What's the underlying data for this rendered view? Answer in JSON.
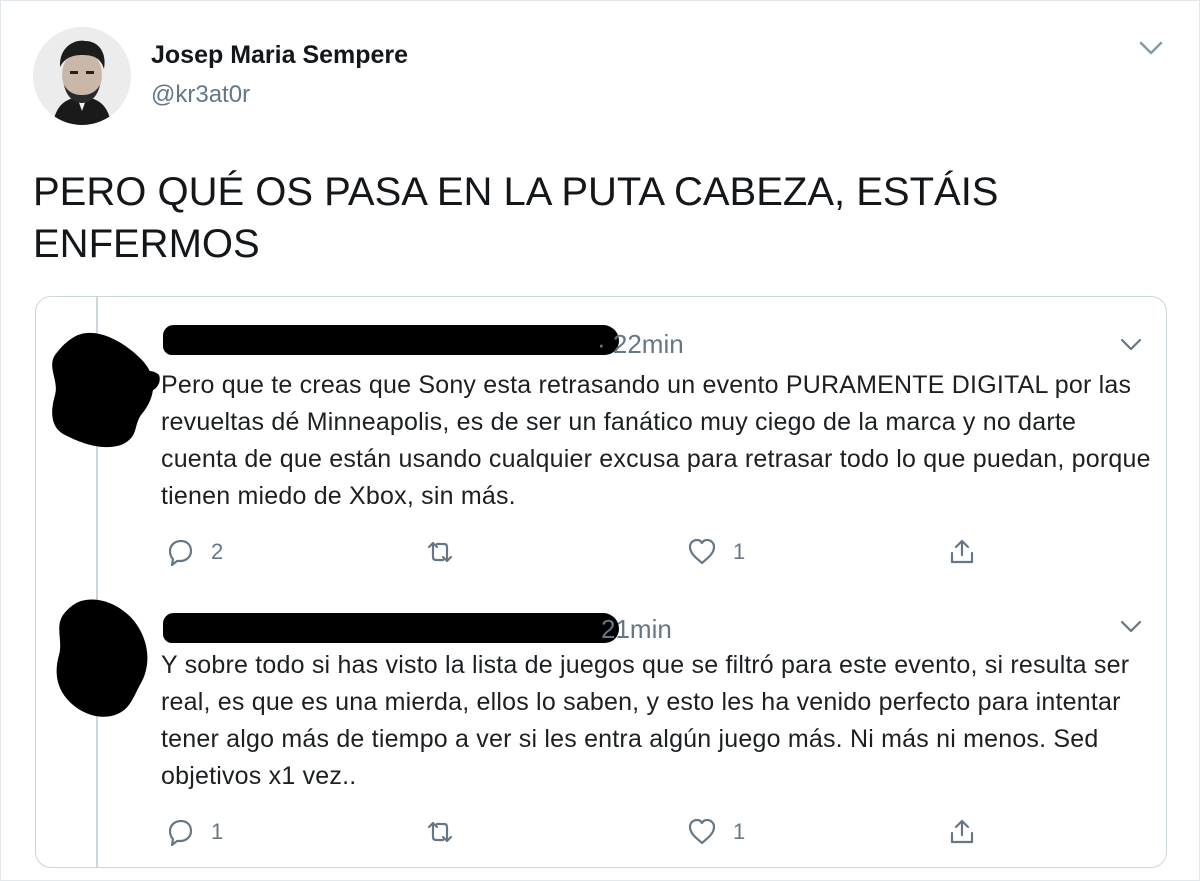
{
  "tweet": {
    "author_name": "Josep Maria Sempere",
    "author_handle": "@kr3at0r",
    "text": "PERO QUÉ OS PASA EN LA PUTA CABEZA, ESTÁIS ENFERMOS"
  },
  "replies": [
    {
      "time": "· 22min",
      "text": "Pero que te creas que Sony esta retrasando un evento PURAMENTE DIGITAL por las revueltas dé Minneapolis, es de ser un fanático muy ciego de la marca y no darte cuenta de que están usando cualquier excusa para retrasar todo lo que puedan, porque tienen miedo de Xbox, sin más.",
      "reply_count": "2",
      "like_count": "1"
    },
    {
      "time": "21min",
      "text": "Y sobre todo si has visto la lista de juegos que se filtró para este evento, si resulta ser real, es que es una mierda, ellos lo saben, y esto les ha venido perfecto para intentar tener algo más de tiempo a ver si les entra algún juego más. Ni más ni menos. Sed objetivos x1 vez..",
      "reply_count": "1",
      "like_count": "1"
    }
  ],
  "icons": {
    "reply": "reply-bubble-icon",
    "retweet": "retweet-icon",
    "like": "heart-icon",
    "share": "share-icon",
    "more": "chevron-down-icon"
  },
  "colors": {
    "text": "#14171a",
    "secondary": "#657786",
    "border": "#ccd6dd"
  }
}
